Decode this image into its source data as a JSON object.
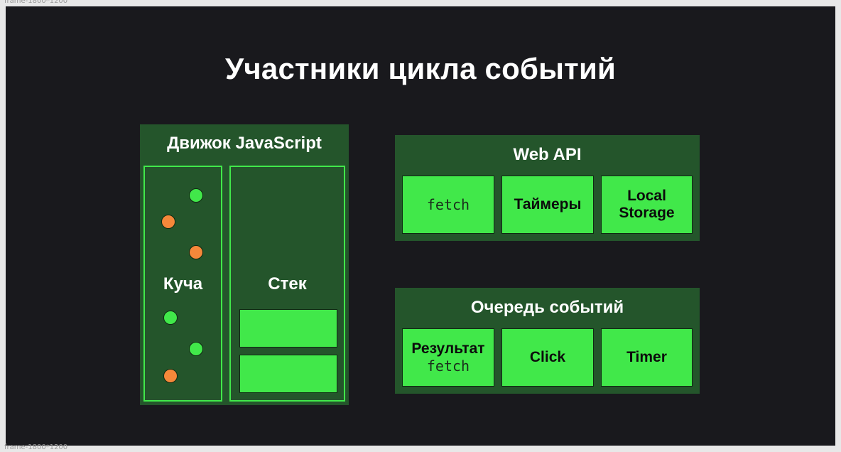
{
  "frame_label": "frame-1800*1200",
  "title": "Участники цикла событий",
  "engine": {
    "title": "Движок JavaScript",
    "heap_label": "Куча",
    "stack_label": "Стек"
  },
  "web_api": {
    "title": "Web API",
    "items": [
      {
        "text": "fetch",
        "mono": true
      },
      {
        "text": "Таймеры",
        "mono": false
      },
      {
        "text": "Local Storage",
        "mono": false
      }
    ]
  },
  "event_queue": {
    "title": "Очередь событий",
    "items": [
      {
        "text": "Результат",
        "code": "fetch"
      },
      {
        "text": "Click"
      },
      {
        "text": "Timer"
      }
    ]
  },
  "colors": {
    "background": "#19191d",
    "panel": "#24552b",
    "accent_green": "#41e84a",
    "accent_orange": "#f5883a"
  }
}
